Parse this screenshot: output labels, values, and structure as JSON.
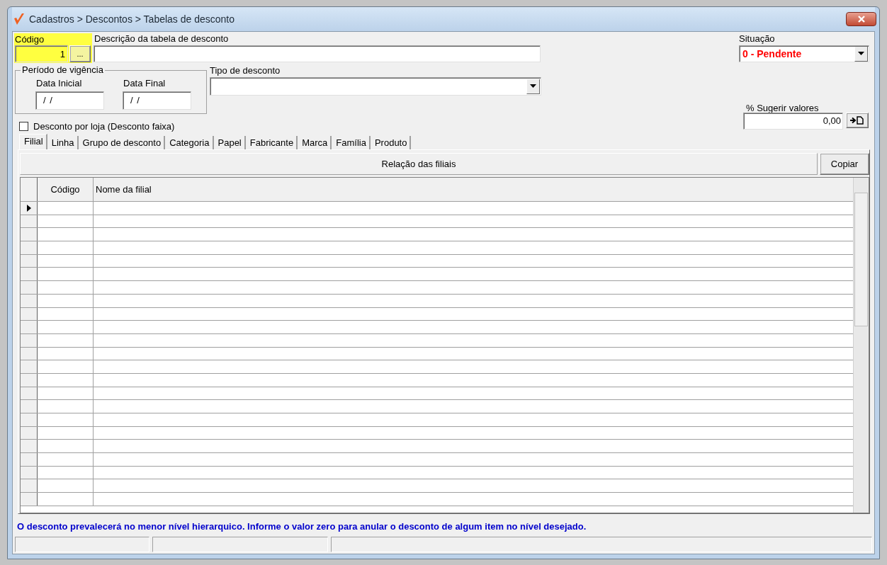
{
  "window": {
    "title": "Cadastros > Descontos > Tabelas de desconto"
  },
  "codigo": {
    "label": "Código",
    "value": "1",
    "lookup_button": "...",
    "highlighted": true
  },
  "descricao": {
    "label": "Descrição da tabela de desconto"
  },
  "situacao": {
    "label": "Situação",
    "value": "0 - Pendente"
  },
  "periodo": {
    "title": "Período de vigência",
    "fields": [
      {
        "label": "Data Inicial",
        "value": "/ /"
      },
      {
        "label": "Data Final",
        "value": "/ /"
      }
    ]
  },
  "tipo_desconto": {
    "label": "Tipo de desconto"
  },
  "desconto_por_loja": {
    "label": "Desconto por loja (Desconto faixa)",
    "checked": false
  },
  "sugerir": {
    "label": "% Sugerir valores",
    "value": "0,00"
  },
  "tabs": [
    {
      "label": "Filial",
      "selected": true
    },
    {
      "label": "Linha",
      "selected": false
    },
    {
      "label": "Grupo de desconto",
      "selected": false
    },
    {
      "label": "Categoria",
      "selected": false
    },
    {
      "label": "Papel",
      "selected": false
    },
    {
      "label": "Fabricante",
      "selected": false
    },
    {
      "label": "Marca",
      "selected": false
    },
    {
      "label": "Família",
      "selected": false
    },
    {
      "label": "Produto",
      "selected": false
    }
  ],
  "panel": {
    "title": "Relação das filiais",
    "copy_button": "Copiar"
  },
  "table": {
    "columns": [
      "Código",
      "Nome da filial"
    ],
    "rows": [
      {
        "selected": true
      },
      {
        "selected": false
      },
      {
        "selected": false
      },
      {
        "selected": false
      },
      {
        "selected": false
      },
      {
        "selected": false
      },
      {
        "selected": false
      },
      {
        "selected": false
      },
      {
        "selected": false
      },
      {
        "selected": false
      },
      {
        "selected": false
      },
      {
        "selected": false
      },
      {
        "selected": false
      },
      {
        "selected": false
      },
      {
        "selected": false
      },
      {
        "selected": false
      },
      {
        "selected": false
      },
      {
        "selected": false
      },
      {
        "selected": false
      },
      {
        "selected": false
      },
      {
        "selected": false
      },
      {
        "selected": false
      },
      {
        "selected": false
      }
    ]
  },
  "footer_message": "O desconto prevalecerá no menor nível hierarquico. Informe o valor zero para anular o desconto de algum item no nível desejado."
}
